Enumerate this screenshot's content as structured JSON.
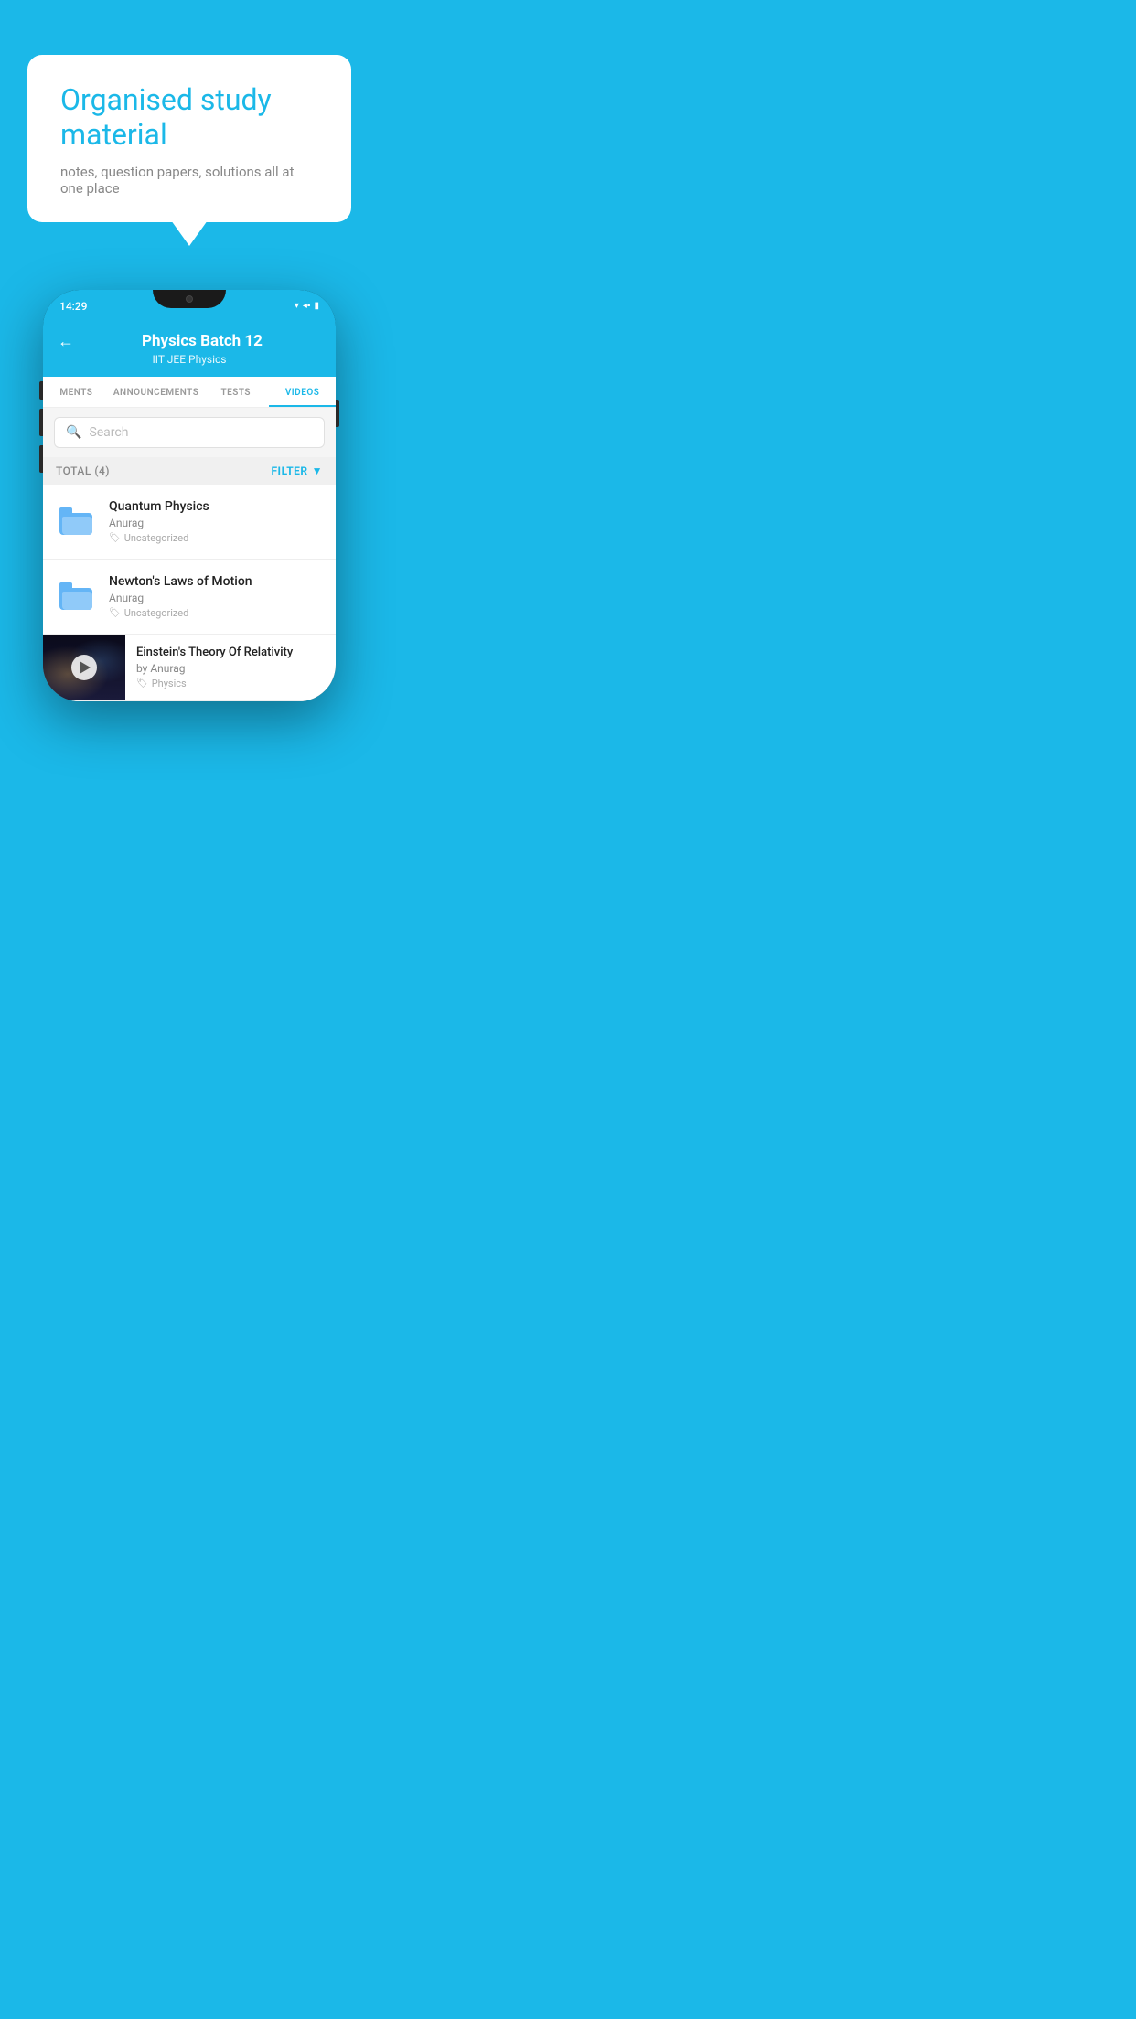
{
  "background_color": "#1BB8E8",
  "speech_bubble": {
    "title": "Organised study material",
    "subtitle": "notes, question papers, solutions all at one place"
  },
  "phone": {
    "status_bar": {
      "time": "14:29",
      "icons": [
        "wifi",
        "signal",
        "battery"
      ]
    },
    "header": {
      "title": "Physics Batch 12",
      "subtitle": "IIT JEE   Physics",
      "back_label": "←"
    },
    "tabs": [
      {
        "label": "MENTS",
        "active": false
      },
      {
        "label": "ANNOUNCEMENTS",
        "active": false
      },
      {
        "label": "TESTS",
        "active": false
      },
      {
        "label": "VIDEOS",
        "active": true
      }
    ],
    "search": {
      "placeholder": "Search"
    },
    "filter": {
      "total_label": "TOTAL (4)",
      "filter_label": "FILTER"
    },
    "list_items": [
      {
        "type": "folder",
        "title": "Quantum Physics",
        "author": "Anurag",
        "tag": "Uncategorized"
      },
      {
        "type": "folder",
        "title": "Newton's Laws of Motion",
        "author": "Anurag",
        "tag": "Uncategorized"
      },
      {
        "type": "video",
        "title": "Einstein's Theory Of Relativity",
        "author": "by Anurag",
        "tag": "Physics"
      }
    ]
  }
}
